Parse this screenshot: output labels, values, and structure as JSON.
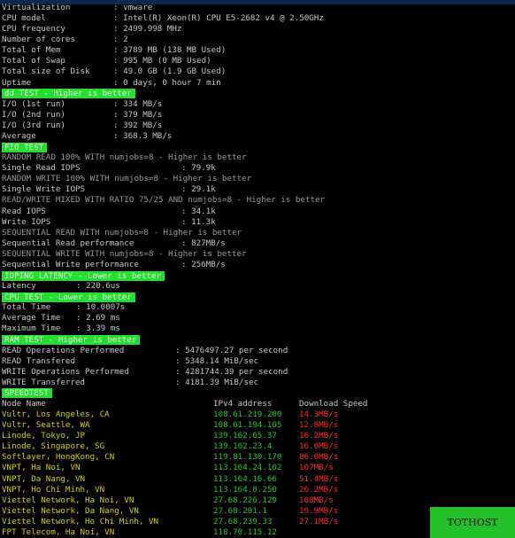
{
  "sysinfo": [
    {
      "label": "Virtualization",
      "value": ": vmware"
    },
    {
      "label": "CPU model",
      "value": ": Intel(R) Xeon(R) CPU E5-2682 v4 @ 2.50GHz"
    },
    {
      "label": "CPU frequency",
      "value": ": 2499.998 MHz"
    },
    {
      "label": "Number of cores",
      "value": ": 2"
    },
    {
      "label": "Total of Mem",
      "value": ": 3789 MB (138 MB Used)"
    },
    {
      "label": "Total of Swap",
      "value": ": 995 MB (0 MB Used)"
    },
    {
      "label": "Total size of Disk",
      "value": ": 49.0 GB (1.9 GB Used)"
    },
    {
      "label": "Uptime",
      "value": ": 0 days, 0 hour 7 min"
    }
  ],
  "dd": {
    "header": "dd TEST - Higher is better",
    "rows": [
      {
        "label": "I/O (1st run)",
        "value": ": 334 MB/s"
      },
      {
        "label": "I/O (2nd run)",
        "value": ": 379 MB/s"
      },
      {
        "label": "I/O (3rd run)",
        "value": ": 392 MB/s"
      },
      {
        "label": "Average",
        "value": ": 368.3 MB/s"
      }
    ]
  },
  "fio": {
    "header": "FIO TEST",
    "rows": [
      {
        "label": "RANDOM READ 100% WITH numjobs=8 - Higher is better",
        "value": "",
        "dim": true
      },
      {
        "label": "Single Read IOPS",
        "value": ": 79.9k"
      },
      {
        "label": "RANDOM WRITE 100% WITH numjobs=8 - Higher is better",
        "value": "",
        "dim": true
      },
      {
        "label": "Single Write IOPS",
        "value": ": 29.1k"
      },
      {
        "label": "READ/WRITE MIXED WITH RATIO 75/25 AND numjobs=8 - Higher is better",
        "value": "",
        "dim": true
      },
      {
        "label": "Read IOPS",
        "value": ": 34.1k"
      },
      {
        "label": "Write IOPS",
        "value": ": 11.3k"
      },
      {
        "label": "SEQUENTIAL READ WITH numjobs=8 - Higher is better",
        "value": "",
        "dim": true
      },
      {
        "label": "Sequential Read performance",
        "value": ": 827MB/s"
      },
      {
        "label": "SEQUENTIAL WRITE WITH numjobs=8 - Higher is better",
        "value": "",
        "dim": true
      },
      {
        "label": "Sequential Write performance",
        "value": ": 256MB/s"
      }
    ]
  },
  "ioping": {
    "header": "IOPING LATENCY - Lower is better",
    "rows": [
      {
        "label": "Latency",
        "value": ": 220.6us"
      }
    ]
  },
  "cpu": {
    "header": "CPU TEST - Lower is better",
    "rows": [
      {
        "label": "Total Time",
        "value": ": 10.0007s"
      },
      {
        "label": "Average Time",
        "value": ": 2.69 ms"
      },
      {
        "label": "Maximum Time",
        "value": ": 3.39 ms"
      }
    ]
  },
  "ram": {
    "header": "RAM TEST - Higher is better",
    "rows": [
      {
        "label": "READ Operations Performed",
        "value": ": 5476497.27 per second"
      },
      {
        "label": "READ Transfered",
        "value": ": 5348.14 MiB/sec"
      },
      {
        "label": "WRITE Operations Performed",
        "value": ": 4281744.39 per second"
      },
      {
        "label": "WRITE Transferred",
        "value": ": 4181.39 MiB/sec"
      }
    ]
  },
  "speedtest": {
    "header": "SPEEDTEST",
    "columns": [
      "Node Name",
      "IPv4 address",
      "Download Speed"
    ],
    "rows": [
      {
        "node": "Vultr, Los Angeles, CA",
        "ip": "108.61.219.200",
        "speed": "14.3MB/s"
      },
      {
        "node": "Vultr, Seattle, WA",
        "ip": "108.61.194.105",
        "speed": "12.8MB/s"
      },
      {
        "node": "Linode, Tokyo, JP",
        "ip": "139.162.65.37",
        "speed": "16.2MB/s"
      },
      {
        "node": "Linode, Singapore, SG",
        "ip": "139.162.23.4",
        "speed": "16.6MB/s"
      },
      {
        "node": "Softlayer, HongKong, CN",
        "ip": "119.81.130.170",
        "speed": "86.0MB/s"
      },
      {
        "node": "VNPT, Ha Noi, VN",
        "ip": "113.164.24.102",
        "speed": "107MB/s"
      },
      {
        "node": "VNPT, Da Nang, VN",
        "ip": "113.164.16.66",
        "speed": "51.4MB/s"
      },
      {
        "node": "VNPT, Ho Chi Minh, VN",
        "ip": "113.164.8.250",
        "speed": "26.2MB/s"
      },
      {
        "node": "Viettel Network, Ha Noi, VN",
        "ip": "27.68.226.129",
        "speed": "108MB/s"
      },
      {
        "node": "Viettel Network, Da Nang, VN",
        "ip": "27.68.201.1",
        "speed": "19.9MB/s"
      },
      {
        "node": "Viettel Network, Ho Chi Minh, VN",
        "ip": "27.68.239.33",
        "speed": "27.1MB/s"
      },
      {
        "node": "FPT Telecom, Ha Noi, VN",
        "ip": "118.70.115.12",
        "speed": ""
      }
    ]
  },
  "button": {
    "label": "TOTHOST"
  },
  "colors": {
    "background": "#000000",
    "text": "#c8c8c8",
    "header_bg": "#22e02c",
    "node_name": "#d4d400",
    "ip_address": "#22c82a",
    "speed": "#ff2b2b",
    "button_bg": "#22c12a"
  }
}
